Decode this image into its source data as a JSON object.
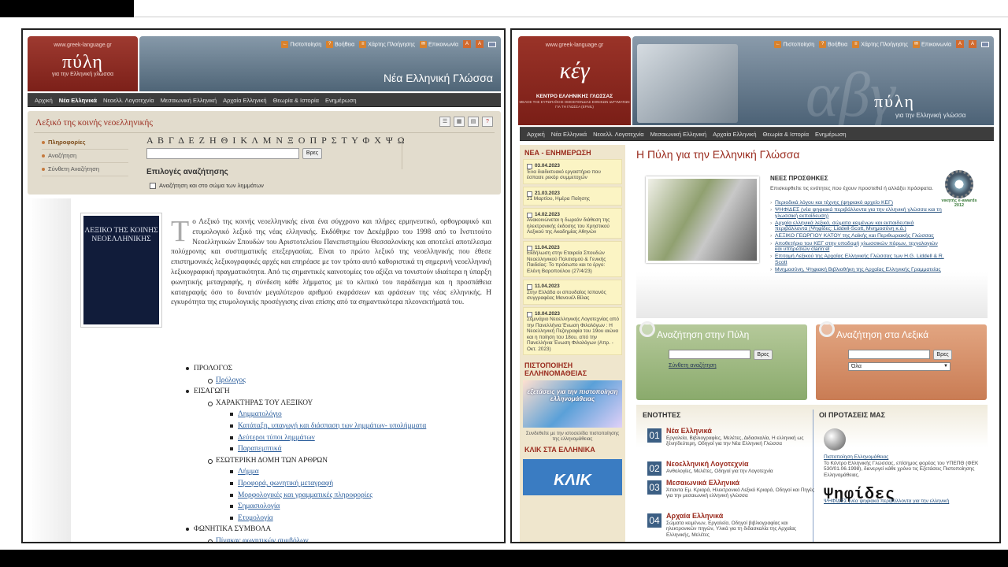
{
  "left": {
    "site_url": "www.greek-language.gr",
    "logo": "πύλη",
    "logo_sub": "για την Ελληνική γλώσσα",
    "header_title": "Νέα Ελληνική Γλώσσα",
    "toplinks": [
      "Πιστοποίηση",
      "Βοήθεια",
      "Χάρτης Πλοήγησης",
      "Επικοινωνία"
    ],
    "nav": [
      "Αρχική",
      "Νέα Ελληνικά",
      "Νεοελλ. Λογοτεχνία",
      "Μεσαιωνική Ελληνική",
      "Αρχαία Ελληνική",
      "Θεωρία & Ιστορία",
      "Ενημέρωση"
    ],
    "search_title": "Λεξικό της κοινής νεοελληνικής",
    "side": [
      "Πληροφορίες",
      "Αναζήτηση",
      "Σύνθετη Αναζήτηση"
    ],
    "alphabet": "Α Β Γ Δ Ε Ζ Η Θ Ι Κ Λ Μ Ν Ξ Ο Π Ρ Σ Τ Υ Φ Χ Ψ Ω",
    "search_button": "Βρες",
    "options_title": "Επιλογές αναζήτησης",
    "checkbox_label": "Αναζήτηση και στο σώμα των λημμάτων",
    "book_title": "ΛΕΞΙΚΟ ΤΗΣ ΚΟΙΝΗΣ ΝΕΟΕΛΛΗΝΙΚΗΣ",
    "drop_cap": "Τ",
    "intro": "ο Λεξικό της κοινής νεοελληνικής είναι ένα σύγχρονο και πλήρες ερμηνευτικό, ορθογραφικό και ετυμολογικό λεξικό της νέας ελληνικής. Εκδόθηκε τον Δεκέμβριο του 1998 από το Ινστιτούτο Νεοελληνικών Σπουδών του Αριστοτελείου Πανεπιστημίου Θεσσαλονίκης και αποτελεί αποτέλεσμα πολύχρονης και συστηματικής επεξεργασίας. Είναι το πρώτο λεξικό της νεοελληνικής που έθεσε επιστημονικές λεξικογραφικές αρχές και επηρέασε με τον τρόπο αυτό καθοριστικά τη σημερινή νεοελληνική λεξικογραφική πραγματικότητα. Από τις σημαντικές καινοτομίες του αξίζει να τονιστούν ιδιαίτερα η ύπαρξη φωνητικής μεταγραφής, η σύνδεση κάθε λήμματος με το κλιτικό του παράδειγμα και η προσπάθεια καταγραφής όσο το δυνατόν μεγαλύτερου αριθμού εκφράσεων και φράσεων της νέας ελληνικής. Η εγκυρότητα της ετυμολογικής προσέγγισης είναι επίσης από τα σημαντικότερα πλεονεκτήματά του.",
    "toc": {
      "prologos": "ΠΡΟΛΟΓΟΣ",
      "prologos_link": "Πρόλογος",
      "eisagogi": "ΕΙΣΑΓΩΓΗ",
      "charaktiras": "ΧΑΡΑΚΤΗΡΑΣ ΤΟΥ ΛΕΞΙΚΟΥ",
      "char_links": [
        "Λημματολόγιο",
        "Κατάταξη, υπαγωγή και διάσπαση των λημμάτων- υπολήμματα",
        "Δεύτεροι τύποι λημμάτων",
        "Παραπεμπτικά"
      ],
      "esoteriki": "ΕΣΩΤΕΡΙΚΗ ΔΟΜΗ ΤΩΝ ΑΡΘΡΩΝ",
      "eso_links": [
        "Λήμμα",
        "Προφορά, φωνητική μεταγραφή",
        "Μορφολογικές και γραμματικές πληροφορίες",
        "Σημασιολογία",
        "Ετυμολογία"
      ],
      "fonitika": "ΦΩΝΗΤΙΚΑ ΣΥΜΒΟΛΑ",
      "fon_link": "Πίνακας φωνητικών συμβόλων"
    }
  },
  "right": {
    "site_url": "www.greek-language.gr",
    "logo": "κέγ",
    "logo_title": "ΚΕΝΤΡΟ ΕΛΛΗΝΙΚΗΣ ΓΛΩΣΣΑΣ",
    "logo_sub": "ΜΕΛΟΣ ΤΗΣ ΕΥΡΩΠΑΪΚΗΣ ΟΜΟΣΠΟΝΔΙΑΣ ΕΘΝΙΚΩΝ ΙΔΡΥΜΑΤΩΝ ΓΙΑ ΤΗ ΓΛΩΣΣΑ (EFNIL)",
    "header_logo": "πύλη",
    "header_sub": "για την Ελληνική γλώσσα",
    "header_ghost": "αβγ",
    "toplinks": [
      "Πιστοποίηση",
      "Βοήθεια",
      "Χάρτης Πλοήγησης",
      "Επικοινωνία"
    ],
    "nav": [
      "Αρχική",
      "Νέα Ελληνικά",
      "Νεοελλ. Λογοτεχνία",
      "Μεσαιωνική Ελληνική",
      "Αρχαία Ελληνική",
      "Θεωρία & Ιστορία",
      "Ενημέρωση"
    ],
    "news_title": "ΝΕΑ - ΕΝΗΜΕΡΩΣΗ",
    "news": [
      {
        "date": "03.04.2023",
        "text": "Ένα διαδικτυακό εργαστήριο που έσπασε ρεκόρ συμμετοχών"
      },
      {
        "date": "21.03.2023",
        "text": "21 Μαρτίου, Ημέρα Ποίησης"
      },
      {
        "date": "14.02.2023",
        "text": "Ανακοινώνεται η δωρεάν διάθεση της ηλεκτρονικής έκδοσης του Χρηστικού Λεξικού της Ακαδημίας Αθηνών"
      },
      {
        "date": "11.04.2023",
        "text": "Εκδήλωση στην Εταιρεία Σπουδών Νεοελληνικού Πολιτισμού & Γενικής Παιδείας: Το πρόσωπο και το έργο: Ελένη Βαροπούλου (27/4/23)"
      },
      {
        "date": "11.04.2023",
        "text": "Στην Ελλάδα οι σπουδαίος Ισπανός συγγραφέας Μανουέλ Βίλας"
      },
      {
        "date": "10.04.2023",
        "text": "Σεμινάριο Νεοελληνικής Λογοτεχνίας από την Πανελλήνια Ένωση Φιλολόγων : Η Νεοελληνική Πεζογραφία του 19ου αιώνα και η ποίηση του 18ου, από την Πανελλήνια Ένωση Φιλολόγων (Απρ. - Οκτ. 2023)"
      }
    ],
    "cert_title": "ΠΙΣΤΟΠΟΙΗΣΗ ΕΛΛΗΝΟΜΑΘΕΙΑΣ",
    "cert_banner": "εξετάσεις για την πιστοποίηση ελληνομάθειας",
    "cert_caption": "Συνδεθείτε με την ιστοσελίδα πιστοποίησης της ελληνομάθειας",
    "klik_title": "ΚΛΙΚ ΣΤΑ ΕΛΛΗΝΙΚΑ",
    "klik_banner": "ΚΛΙΚ",
    "main_title": "Η Πύλη για την Ελληνική Γλώσσα",
    "new_head": "ΝΕΕΣ ΠΡΟΣΘΗΚΕΣ",
    "new_intro": "Επισκεφθείτε τις ενότητες που έχουν προστεθεί ή αλλάξει πρόσφατα.",
    "new_items": [
      "Περιοδικά λόγου και τέχνης (ψηφιακό αρχείο ΚΕΓ)",
      "ΨΗΦΙΔΕΣ (νέα ψηφιακά περιβάλλοντα για την ελληνική γλώσσα και τη γλωσσική εκπαίδευση)",
      "Αρχαία ελληνικά λεξικά, σώματα κειμένων και εκπαιδευτικά περιβάλλοντα (Ψηφίδες: Liddell-Scott, Μνημοσύνη κ.ά.)",
      "ΛΕΞΙΚΟ ΓΕΩΡΓΙΟΥ ΚΑΤΟΥ της Λαϊκής και Περιθωριακής Γλώσσας",
      "Αποθετήριο του ΚΕΓ στην υποδομή γλωσσικών πόρων, τεχνολογιών και υπηρεσιών clarin:el",
      "Επιτομή Λεξικού της Αρχαίας Ελληνικής Γλώσσας των H.G. Liddell & R. Scott",
      "Μνημοσύνη, Ψηφιακή Βιβλιοθήκη της Αρχαίας Ελληνικής Γραμματείας"
    ],
    "award_text": "νικητής e-awards 2012",
    "search_portal": "Αναζήτηση στην Πύλη",
    "search_dicts": "Αναζήτηση στα Λεξικά",
    "search_button": "Βρες",
    "adv_search": "Σύνθετη αναζήτηση",
    "select_value": "Όλα",
    "sections_title": "ΕΝΟΤΗΤΕΣ",
    "proposals_title": "ΟΙ ΠΡΟΤΑΣΕΙΣ ΜΑΣ",
    "sections": [
      {
        "num": "01",
        "title": "Νέα Ελληνικά",
        "desc": "Εργαλεία, Βιβλιογραφίες, Μελέτες, Διδασκαλία, Η ελληνική ως ξένη/δεύτερη, Οδηγοί για την Νέα Ελληνική Γλώσσα"
      },
      {
        "num": "02",
        "title": "Νεοελληνική Λογοτεχνία",
        "desc": "Ανθολογίες, Μελέτες, Οδηγοί για την Λογοτεχνία"
      },
      {
        "num": "03",
        "title": "Μεσαιωνικά Ελληνικά",
        "desc": "Άπαντα Εμ. Κριαρά, Ηλεκτρονικό Λεξικό Κριαρά, Οδηγοί και Πηγές για την μεσαιωνική ελληνική γλώσσα"
      },
      {
        "num": "04",
        "title": "Αρχαία Ελληνικά",
        "desc": "Σώματα κειμένων, Εργαλεία, Οδηγοί βιβλιογραφίας και ηλεκτρονικών πηγών, Υλικά για τη διδασκαλία της Αρχαίας Ελληνικής, Μελέτες"
      }
    ],
    "prop_link": "Πιστοποίηση Ελληνομάθειας",
    "prop_desc": "Το Κέντρο Ελληνικής Γλώσσας, επίσημος φορέας του ΥΠΕΠΘ (ΦΕΚ 530/01.06.1998), διενεργεί κάθε χρόνο τις Εξετάσεις Πιστοποίησης Ελληνομάθειας.",
    "psifides": "Ψηφίδες",
    "psifides_caption": "ΨΗΦΙΔΕΣ (νέα ψηφιακά περιβάλλοντα για την ελληνική"
  }
}
